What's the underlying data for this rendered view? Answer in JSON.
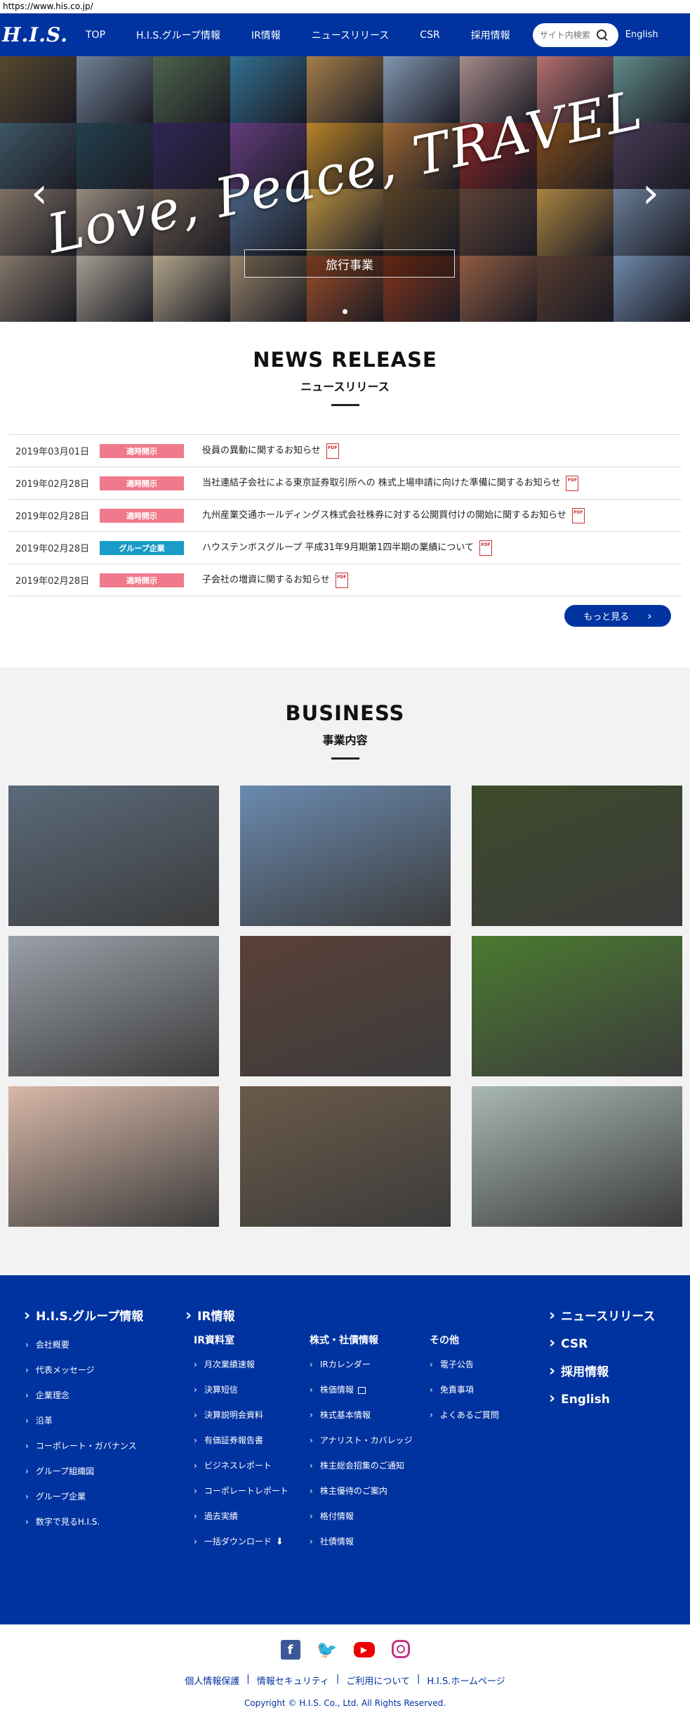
{
  "url": "https://www.his.co.jp/",
  "header": {
    "logo": "H.I.S.",
    "nav": [
      "TOP",
      "H.I.S.グループ情報",
      "IR情報",
      "ニュースリリース",
      "CSR",
      "採用情報"
    ],
    "search_placeholder": "サイト内検索",
    "lang": "English"
  },
  "hero": {
    "title": "Love, Peace, TRAVEL",
    "label": "旅行事業",
    "prev": "‹",
    "next": "›",
    "tile_colors": [
      "#6c5a3a",
      "#8aa0b8",
      "#5f7a5e",
      "#3d8ab3",
      "#c99a5a",
      "#9fb8d8",
      "#caa",
      "#d88",
      "#7aa",
      "#4a6a7a",
      "#2b4f5f",
      "#3b2f6a",
      "#7a4a9a",
      "#e0a030",
      "#c08040",
      "#b03030",
      "#a06020",
      "#5a4a6a",
      "#9a8a7a",
      "#b8a898",
      "#7a6a5a",
      "#5a7aa0",
      "#e0b050",
      "#6a5030",
      "#705040",
      "#d0a050",
      "#8098b8",
      "#a09080",
      "#c8c0b0",
      "#d8c8a8",
      "#b8a080",
      "#c06030",
      "#a04020",
      "#b07050",
      "#6a4a3a",
      "#88a8d0"
    ]
  },
  "news": {
    "title": "NEWS RELEASE",
    "subtitle": "ニュースリリース",
    "items": [
      {
        "date": "2019年03月01日",
        "badge": "適時開示",
        "color": "#f07a8c",
        "title": "役員の異動に関するお知らせ"
      },
      {
        "date": "2019年02月28日",
        "badge": "適時開示",
        "color": "#f07a8c",
        "title": "当社連結子会社による東京証券取引所への 株式上場申請に向けた準備に関するお知らせ"
      },
      {
        "date": "2019年02月28日",
        "badge": "適時開示",
        "color": "#f07a8c",
        "title": "九州産業交通ホールディングス株式会社株券に対する公開買付けの開始に関するお知らせ"
      },
      {
        "date": "2019年02月28日",
        "badge": "グループ企業",
        "color": "#1a9bc8",
        "title": "ハウステンボスグループ 平成31年9月期第1四半期の業績について"
      },
      {
        "date": "2019年02月28日",
        "badge": "適時開示",
        "color": "#f07a8c",
        "title": "子会社の増資に関するお知らせ"
      }
    ],
    "more": "もっと見る"
  },
  "business": {
    "title": "BUSINESS",
    "subtitle": "事業内容",
    "tiles": [
      {
        "icon": "traveler-image",
        "color": "#5a6a7a"
      },
      {
        "icon": "windmill-tulip-image",
        "color": "#6a8ab0"
      },
      {
        "icon": "hotel-robot-image",
        "color": "#3d4a2a"
      },
      {
        "icon": "bus-image",
        "color": "#9aa0a8"
      },
      {
        "icon": "robot-arm-image",
        "color": "#5a4038"
      },
      {
        "icon": "tea-leaves-image",
        "color": "#4a7a30"
      },
      {
        "icon": "heart-hands-image",
        "color": "#d8b8a8"
      },
      {
        "icon": "laptops-desk-image",
        "color": "#6a5a48"
      },
      {
        "icon": "map-airplane-image",
        "color": "#a8b8b0"
      }
    ]
  },
  "footer": {
    "group": {
      "heading": "H.I.S.グループ情報",
      "links": [
        "会社概要",
        "代表メッセージ",
        "企業理念",
        "沿革",
        "コーポレート・ガバナンス",
        "グループ組織図",
        "グループ企業",
        "数字で見るH.I.S."
      ]
    },
    "ir": {
      "heading": "IR情報"
    },
    "ir_lib": {
      "heading": "IR資料室",
      "links": [
        "月次業績速報",
        "決算短信",
        "決算説明会資料",
        "有価証券報告書",
        "ビジネスレポート",
        "コーポレートレポート",
        "過去実績",
        "一括ダウンロード"
      ]
    },
    "stock": {
      "heading": "株式・社債情報",
      "links": [
        "IRカレンダー",
        "株価情報",
        "株式基本情報",
        "アナリスト・カバレッジ",
        "株主総会招集のご通知",
        "株主優待のご案内",
        "格付情報",
        "社債情報"
      ]
    },
    "other": {
      "heading": "その他",
      "links": [
        "電子公告",
        "免責事項",
        "よくあるご質問"
      ]
    },
    "right": [
      "ニュースリリース",
      "CSR",
      "採用情報",
      "English"
    ]
  },
  "bottom": {
    "links": [
      "個人情報保護",
      "情報セキュリティ",
      "ご利用について",
      "H.I.S.ホームページ"
    ],
    "copyright": "Copyright © H.I.S. Co., Ltd. All Rights Reserved."
  }
}
